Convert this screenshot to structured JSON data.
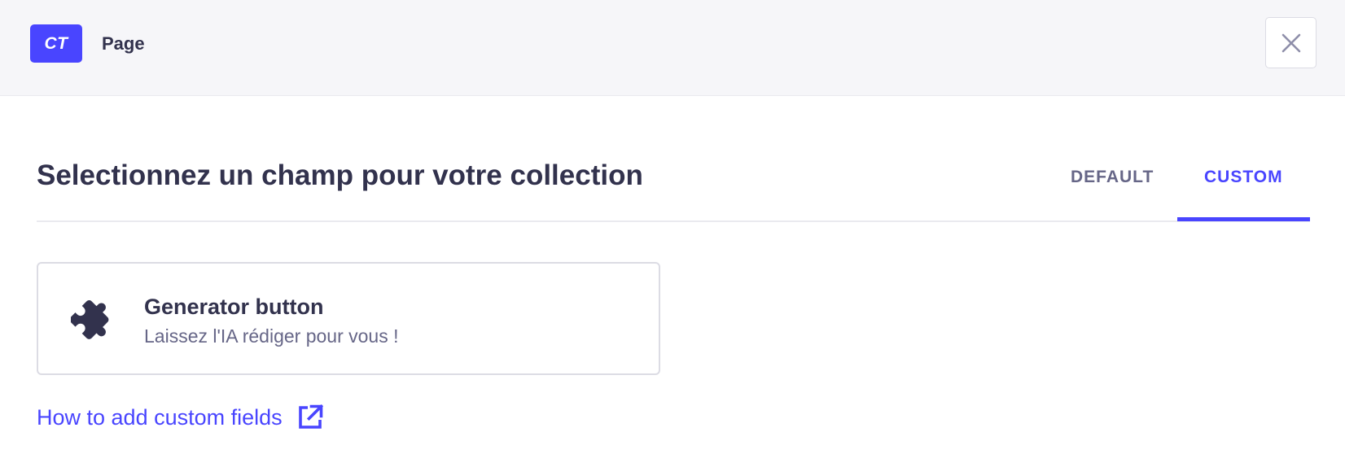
{
  "header": {
    "badge": "CT",
    "page_name": "Page",
    "close_icon": "close-icon"
  },
  "modal": {
    "title": "Selectionnez un champ pour votre collection",
    "tabs": [
      {
        "label": "DEFAULT",
        "active": false
      },
      {
        "label": "CUSTOM",
        "active": true
      }
    ]
  },
  "custom_fields": [
    {
      "icon": "puzzle-icon",
      "name": "Generator button",
      "description": "Laissez l'IA rédiger pour vous !"
    }
  ],
  "help_link": {
    "label": "How to add custom fields",
    "icon": "external-link-icon"
  },
  "colors": {
    "accent": "#4945ff",
    "text_primary": "#32324d",
    "text_secondary": "#666687",
    "header_bg": "#f6f6f9"
  }
}
